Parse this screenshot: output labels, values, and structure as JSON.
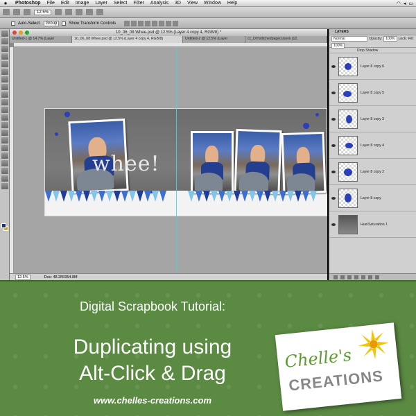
{
  "menubar": {
    "apple": "",
    "items": [
      "Photoshop",
      "File",
      "Edit",
      "Image",
      "Layer",
      "Select",
      "Filter",
      "Analysis",
      "3D",
      "View",
      "Window",
      "Help"
    ]
  },
  "appbar": {
    "zoom": "12.5%"
  },
  "options": {
    "auto_select_label": "Auto-Select:",
    "auto_select_value": "Group",
    "transform_label": "Show Transform Controls"
  },
  "document": {
    "title": "10_06_08 Whee.psd @ 12.5% (Layer 4 copy 4, RGB/8) *",
    "tabs": [
      "Untitled-1 @ 14.7% (Layer",
      "10_06_08 Whee.psd @ 12.5% (Layer 4 copy 4, RGB/8)",
      "Untitled-2 @ 12.5% (Layer",
      "cc_DIYstitchedpagecutaws (12,"
    ],
    "layout_text": "whee!",
    "status_zoom": "12.5%",
    "status_doc": "Doc: 48.2M/354.8M"
  },
  "layers_panel": {
    "tab_label": "LAYERS",
    "mode": "Normal",
    "opacity_label": "Opacity:",
    "opacity_value": "100%",
    "lock_label": "Lock:",
    "fill_label": "Fill:",
    "fill_value": "100%",
    "fx_label": "Drop Shadow",
    "layers": [
      {
        "name": "Layer 8 copy 6"
      },
      {
        "name": "Layer 8 copy 5"
      },
      {
        "name": "Layer 8 copy 3"
      },
      {
        "name": "Layer 8 copy 4"
      },
      {
        "name": "Layer 8 copy 2"
      },
      {
        "name": "Layer 8 copy"
      },
      {
        "name": "Hue/Saturation 1"
      }
    ]
  },
  "promo": {
    "subtitle": "Digital Scrapbook Tutorial:",
    "title_line1": "Duplicating using",
    "title_line2": "Alt-Click & Drag",
    "url": "www.chelles-creations.com",
    "logo_script": "Chelle's",
    "logo_caps": "CREATIONS"
  },
  "colors": {
    "promo_green": "#5b8a43",
    "splatter_blue": "#2b3fbb",
    "guide_cyan": "#4fd0e0",
    "logo_green": "#5d9a2f",
    "sun_yellow": "#f2c500"
  }
}
